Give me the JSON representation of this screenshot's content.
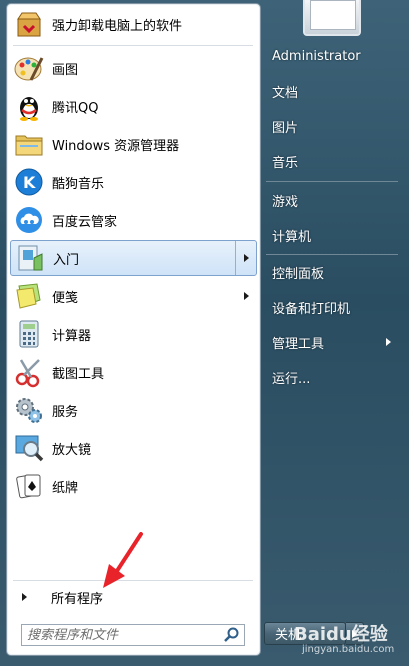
{
  "start_menu": {
    "programs": [
      {
        "label": "强力卸载电脑上的软件",
        "icon": "uninstall-box-icon"
      },
      {
        "label": "画图",
        "icon": "paint-palette-icon"
      },
      {
        "label": "腾讯QQ",
        "icon": "qq-penguin-icon"
      },
      {
        "label": "Windows 资源管理器",
        "icon": "folder-explorer-icon"
      },
      {
        "label": "酷狗音乐",
        "icon": "kugou-music-icon"
      },
      {
        "label": "百度云管家",
        "icon": "baidu-cloud-icon"
      },
      {
        "label": "入门",
        "icon": "getting-started-icon"
      },
      {
        "label": "便笺",
        "icon": "sticky-notes-icon"
      },
      {
        "label": "计算器",
        "icon": "calculator-icon"
      },
      {
        "label": "截图工具",
        "icon": "snipping-tool-icon"
      },
      {
        "label": "服务",
        "icon": "services-gears-icon"
      },
      {
        "label": "放大镜",
        "icon": "magnifier-icon"
      },
      {
        "label": "纸牌",
        "icon": "solitaire-cards-icon"
      }
    ],
    "all_programs_label": "所有程序",
    "search_placeholder": "搜索程序和文件"
  },
  "right_panel": {
    "user": "Administrator",
    "items": [
      "文档",
      "图片",
      "音乐",
      "游戏",
      "计算机",
      "控制面板",
      "设备和打印机",
      "管理工具",
      "运行..."
    ],
    "shutdown_label": "关机"
  },
  "watermark": {
    "text": "Baidu经验",
    "sub": "jingyan.baidu.com"
  },
  "colors": {
    "highlight": "#cfe3f8",
    "right_bg": "#2a4d61",
    "arrow": "#e8232a"
  }
}
